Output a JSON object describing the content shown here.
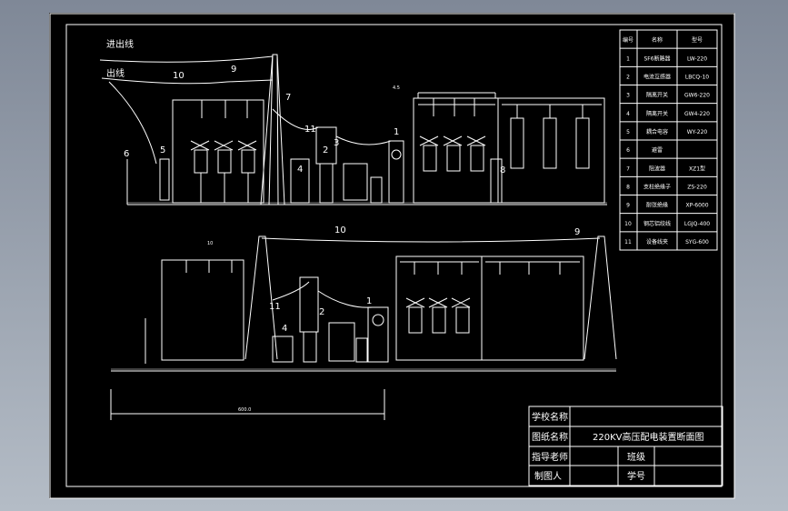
{
  "drawing": {
    "top_labels": {
      "incoming_line": "进出线",
      "outgoing_line": "出线"
    },
    "callouts_top": [
      "10",
      "9",
      "7",
      "11",
      "3",
      "1",
      "4",
      "2",
      "8",
      "6",
      "5"
    ],
    "callouts_bottom": [
      "10",
      "9",
      "11",
      "4",
      "2",
      "1"
    ],
    "small_text_top": "4.5",
    "small_text_left": "10",
    "dimension_text": "600.0"
  },
  "parts_table": {
    "headers": [
      "编号",
      "名称",
      "型号"
    ],
    "rows": [
      [
        "1",
        "SF6断路器",
        "LW-220"
      ],
      [
        "2",
        "电流互感器",
        "LBCQ-10"
      ],
      [
        "3",
        "隔离开关",
        "GW6-220"
      ],
      [
        "4",
        "隔离开关",
        "GW4-220"
      ],
      [
        "5",
        "耦合电容",
        "WY-220"
      ],
      [
        "6",
        "避雷",
        ""
      ],
      [
        "7",
        "阻波器",
        "XZ1型"
      ],
      [
        "8",
        "支柱绝缘子",
        "ZS-220"
      ],
      [
        "9",
        "耐张绝缘",
        "XP-6000"
      ],
      [
        "10",
        "钢芯铝绞线",
        "LGJQ-400"
      ],
      [
        "11",
        "设备线夹",
        "SYG-600"
      ]
    ]
  },
  "title_block": {
    "school_label": "学校名称",
    "drawing_name_label": "图纸名称",
    "drawing_name_value": "220KV高压配电装置断面图",
    "advisor_label": "指导老师",
    "class_label": "班级",
    "drafter_label": "制图人",
    "student_id_label": "学号"
  },
  "colors": {
    "background": "#000000",
    "lines": "#ffffff",
    "viewport": "#9aa3b0"
  }
}
